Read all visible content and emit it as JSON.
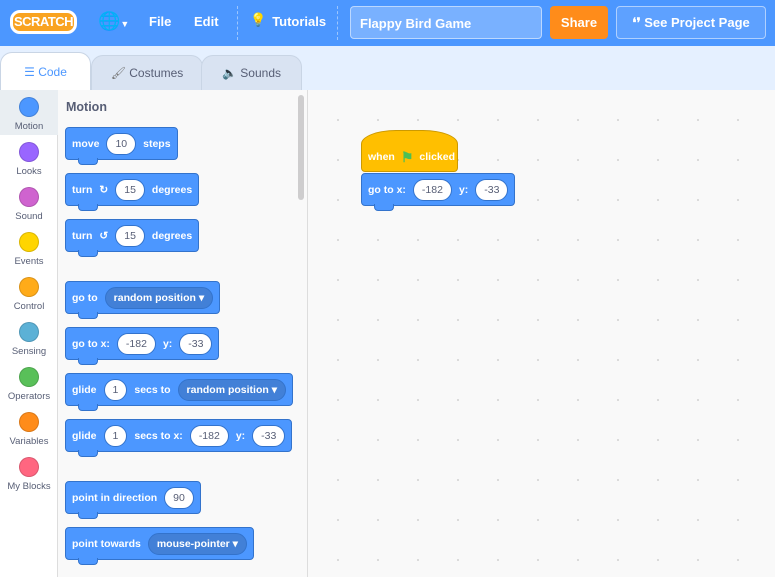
{
  "topbar": {
    "logo": "SCRATCH",
    "file": "File",
    "edit": "Edit",
    "tutorials": "Tutorials",
    "project_title": "Flappy Bird Game",
    "share": "Share",
    "see_project_page": "See Project Page"
  },
  "tabs": [
    {
      "label": "Code"
    },
    {
      "label": "Costumes"
    },
    {
      "label": "Sounds"
    }
  ],
  "categories": [
    {
      "label": "Motion",
      "color": "#4c97ff"
    },
    {
      "label": "Looks",
      "color": "#9966ff"
    },
    {
      "label": "Sound",
      "color": "#cf63cf"
    },
    {
      "label": "Events",
      "color": "#ffd500"
    },
    {
      "label": "Control",
      "color": "#ffab19"
    },
    {
      "label": "Sensing",
      "color": "#5cb1d6"
    },
    {
      "label": "Operators",
      "color": "#59c059"
    },
    {
      "label": "Variables",
      "color": "#ff8c1a"
    },
    {
      "label": "My Blocks",
      "color": "#ff6680"
    }
  ],
  "palette": {
    "heading": "Motion",
    "move": {
      "a": "move",
      "n": "10",
      "b": "steps"
    },
    "turn_right": {
      "a": "turn",
      "n": "15",
      "b": "degrees"
    },
    "turn_left": {
      "a": "turn",
      "n": "15",
      "b": "degrees"
    },
    "goto": {
      "a": "go to",
      "d": "random position"
    },
    "gotoxy": {
      "a": "go to x:",
      "x": "-182",
      "b": "y:",
      "y": "-33"
    },
    "glide": {
      "a": "glide",
      "n": "1",
      "b": "secs to",
      "d": "random position"
    },
    "glidexy": {
      "a": "glide",
      "n": "1",
      "b": "secs to x:",
      "x": "-182",
      "c": "y:",
      "y": "-33"
    },
    "point_dir": {
      "a": "point in direction",
      "n": "90"
    },
    "point_towards": {
      "a": "point towards",
      "d": "mouse-pointer"
    }
  },
  "workspace": {
    "hat": {
      "a": "when",
      "b": "clicked"
    },
    "gotoxy": {
      "a": "go to x:",
      "x": "-182",
      "b": "y:",
      "y": "-33"
    }
  }
}
